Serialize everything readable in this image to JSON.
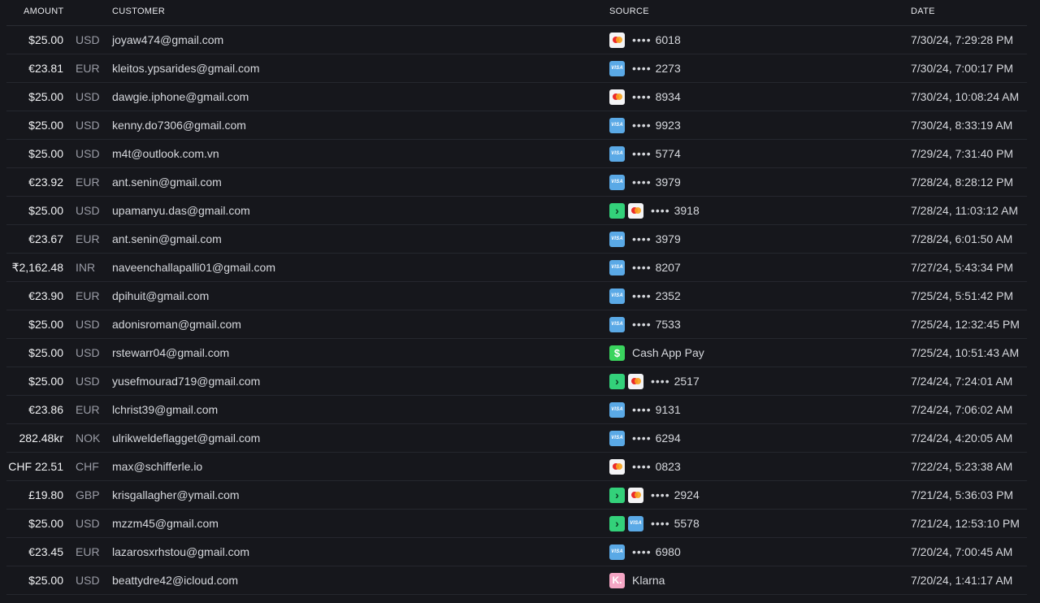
{
  "headers": {
    "amount": "AMOUNT",
    "customer": "CUSTOMER",
    "source": "SOURCE",
    "date": "DATE"
  },
  "rows": [
    {
      "amount": "$25.00",
      "currency": "USD",
      "customer": "joyaw474@gmail.com",
      "source": {
        "icons": [
          "mastercard-icon"
        ],
        "dots": "••••",
        "last4": "6018",
        "label": ""
      },
      "date": "7/30/24, 7:29:28 PM"
    },
    {
      "amount": "€23.81",
      "currency": "EUR",
      "customer": "kleitos.ypsarides@gmail.com",
      "source": {
        "icons": [
          "visa-icon"
        ],
        "dots": "••••",
        "last4": "2273",
        "label": ""
      },
      "date": "7/30/24, 7:00:17 PM"
    },
    {
      "amount": "$25.00",
      "currency": "USD",
      "customer": "dawgie.iphone@gmail.com",
      "source": {
        "icons": [
          "mastercard-icon"
        ],
        "dots": "••••",
        "last4": "8934",
        "label": ""
      },
      "date": "7/30/24, 10:08:24 AM"
    },
    {
      "amount": "$25.00",
      "currency": "USD",
      "customer": "kenny.do7306@gmail.com",
      "source": {
        "icons": [
          "visa-icon"
        ],
        "dots": "••••",
        "last4": "9923",
        "label": ""
      },
      "date": "7/30/24, 8:33:19 AM"
    },
    {
      "amount": "$25.00",
      "currency": "USD",
      "customer": "m4t@outlook.com.vn",
      "source": {
        "icons": [
          "visa-icon"
        ],
        "dots": "••••",
        "last4": "5774",
        "label": ""
      },
      "date": "7/29/24, 7:31:40 PM"
    },
    {
      "amount": "€23.92",
      "currency": "EUR",
      "customer": "ant.senin@gmail.com",
      "source": {
        "icons": [
          "visa-icon"
        ],
        "dots": "••••",
        "last4": "3979",
        "label": ""
      },
      "date": "7/28/24, 8:28:12 PM"
    },
    {
      "amount": "$25.00",
      "currency": "USD",
      "customer": "upamanyu.das@gmail.com",
      "source": {
        "icons": [
          "link-icon",
          "mastercard-icon"
        ],
        "dots": "••••",
        "last4": "3918",
        "label": ""
      },
      "date": "7/28/24, 11:03:12 AM"
    },
    {
      "amount": "€23.67",
      "currency": "EUR",
      "customer": "ant.senin@gmail.com",
      "source": {
        "icons": [
          "visa-icon"
        ],
        "dots": "••••",
        "last4": "3979",
        "label": ""
      },
      "date": "7/28/24, 6:01:50 AM"
    },
    {
      "amount": "₹2,162.48",
      "currency": "INR",
      "customer": "naveenchallapalli01@gmail.com",
      "source": {
        "icons": [
          "visa-icon"
        ],
        "dots": "••••",
        "last4": "8207",
        "label": ""
      },
      "date": "7/27/24, 5:43:34 PM"
    },
    {
      "amount": "€23.90",
      "currency": "EUR",
      "customer": "dpihuit@gmail.com",
      "source": {
        "icons": [
          "visa-icon"
        ],
        "dots": "••••",
        "last4": "2352",
        "label": ""
      },
      "date": "7/25/24, 5:51:42 PM"
    },
    {
      "amount": "$25.00",
      "currency": "USD",
      "customer": "adonisroman@gmail.com",
      "source": {
        "icons": [
          "visa-icon"
        ],
        "dots": "••••",
        "last4": "7533",
        "label": ""
      },
      "date": "7/25/24, 12:32:45 PM"
    },
    {
      "amount": "$25.00",
      "currency": "USD",
      "customer": "rstewarr04@gmail.com",
      "source": {
        "icons": [
          "cash-app-icon"
        ],
        "dots": "",
        "last4": "",
        "label": "Cash App Pay"
      },
      "date": "7/25/24, 10:51:43 AM"
    },
    {
      "amount": "$25.00",
      "currency": "USD",
      "customer": "yusefmourad719@gmail.com",
      "source": {
        "icons": [
          "link-icon",
          "mastercard-icon"
        ],
        "dots": "••••",
        "last4": "2517",
        "label": ""
      },
      "date": "7/24/24, 7:24:01 AM"
    },
    {
      "amount": "€23.86",
      "currency": "EUR",
      "customer": "lchrist39@gmail.com",
      "source": {
        "icons": [
          "visa-icon"
        ],
        "dots": "••••",
        "last4": "9131",
        "label": ""
      },
      "date": "7/24/24, 7:06:02 AM"
    },
    {
      "amount": "282.48kr",
      "currency": "NOK",
      "customer": "ulrikweldeflagget@gmail.com",
      "source": {
        "icons": [
          "visa-icon"
        ],
        "dots": "••••",
        "last4": "6294",
        "label": ""
      },
      "date": "7/24/24, 4:20:05 AM"
    },
    {
      "amount": "CHF 22.51",
      "currency": "CHF",
      "customer": "max@schifferle.io",
      "source": {
        "icons": [
          "mastercard-icon"
        ],
        "dots": "••••",
        "last4": "0823",
        "label": ""
      },
      "date": "7/22/24, 5:23:38 AM"
    },
    {
      "amount": "£19.80",
      "currency": "GBP",
      "customer": "krisgallagher@ymail.com",
      "source": {
        "icons": [
          "link-icon",
          "mastercard-icon"
        ],
        "dots": "••••",
        "last4": "2924",
        "label": ""
      },
      "date": "7/21/24, 5:36:03 PM"
    },
    {
      "amount": "$25.00",
      "currency": "USD",
      "customer": "mzzm45@gmail.com",
      "source": {
        "icons": [
          "link-icon",
          "visa-icon"
        ],
        "dots": "••••",
        "last4": "5578",
        "label": ""
      },
      "date": "7/21/24, 12:53:10 PM"
    },
    {
      "amount": "€23.45",
      "currency": "EUR",
      "customer": "lazarosxrhstou@gmail.com",
      "source": {
        "icons": [
          "visa-icon"
        ],
        "dots": "••••",
        "last4": "6980",
        "label": ""
      },
      "date": "7/20/24, 7:00:45 AM"
    },
    {
      "amount": "$25.00",
      "currency": "USD",
      "customer": "beattydre42@icloud.com",
      "source": {
        "icons": [
          "klarna-icon"
        ],
        "dots": "",
        "last4": "",
        "label": "Klarna"
      },
      "date": "7/20/24, 1:41:17 AM"
    }
  ],
  "icon_glyphs": {
    "visa-icon": "VISA",
    "link-icon": "›",
    "cash-app-icon": "$",
    "klarna-icon": "K."
  }
}
